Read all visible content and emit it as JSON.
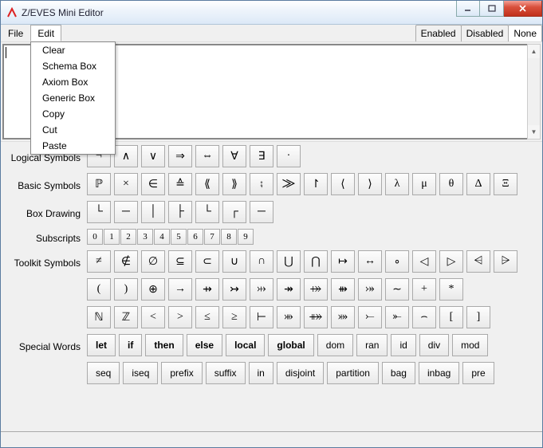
{
  "window": {
    "title": "Z/EVES Mini Editor"
  },
  "menubar": {
    "file": "File",
    "edit": "Edit",
    "filters": {
      "enabled": "Enabled",
      "disabled": "Disabled",
      "none": "None"
    }
  },
  "editMenu": {
    "clear": "Clear",
    "schemaBox": "Schema Box",
    "axiomBox": "Axiom Box",
    "genericBox": "Generic Box",
    "copy": "Copy",
    "cut": "Cut",
    "paste": "Paste"
  },
  "palette": {
    "labels": {
      "logical": "Logical Symbols",
      "basic": "Basic Symbols",
      "box": "Box Drawing",
      "subscripts": "Subscripts",
      "toolkit": "Toolkit Symbols",
      "special": "Special Words"
    },
    "logical": [
      "¬",
      "∧",
      "∨",
      "⇒",
      "⇔",
      "∀",
      "∃",
      "·"
    ],
    "basic": [
      "ℙ",
      "×",
      "∈",
      "≙",
      "⟪",
      "⟫",
      "⨟",
      "⨠",
      "↾",
      "⟨",
      "⟩",
      "λ",
      "μ",
      "θ",
      "Δ",
      "Ξ"
    ],
    "box": [
      "└",
      "─",
      "│",
      "├",
      "└",
      "┌",
      "─"
    ],
    "subscripts": [
      "0",
      "1",
      "2",
      "3",
      "4",
      "5",
      "6",
      "7",
      "8",
      "9"
    ],
    "toolkit1": [
      "≠",
      "∉",
      "∅",
      "⊆",
      "⊂",
      "∪",
      "∩",
      "⋃",
      "⋂",
      "↦",
      "↔",
      "∘",
      "◁",
      "▷",
      "⩤",
      "⩥"
    ],
    "toolkit2": [
      "(",
      ")",
      "⊕",
      "→",
      "⇸",
      "↣",
      "⤔",
      "↠",
      "⤀",
      "⇻",
      "⤖",
      "∼",
      "+",
      "*"
    ],
    "toolkit3": [
      "ℕ",
      "ℤ",
      "<",
      ">",
      "≤",
      "≥",
      "⊢",
      "⤕",
      "⤁",
      "⤗",
      "⤚",
      "⤜",
      "⌢",
      "[",
      "]"
    ],
    "special1": [
      {
        "t": "let",
        "b": true
      },
      {
        "t": "if",
        "b": true
      },
      {
        "t": "then",
        "b": true
      },
      {
        "t": "else",
        "b": true
      },
      {
        "t": "local",
        "b": true
      },
      {
        "t": "global",
        "b": true
      },
      {
        "t": "dom",
        "b": false
      },
      {
        "t": "ran",
        "b": false
      },
      {
        "t": "id",
        "b": false
      },
      {
        "t": "div",
        "b": false
      },
      {
        "t": "mod",
        "b": false
      }
    ],
    "special2": [
      {
        "t": "seq",
        "b": false
      },
      {
        "t": "iseq",
        "b": false
      },
      {
        "t": "prefix",
        "b": false
      },
      {
        "t": "suffix",
        "b": false
      },
      {
        "t": "in",
        "b": false
      },
      {
        "t": "disjoint",
        "b": false
      },
      {
        "t": "partition",
        "b": false
      },
      {
        "t": "bag",
        "b": false
      },
      {
        "t": "inbag",
        "b": false
      },
      {
        "t": "pre",
        "b": false
      }
    ]
  }
}
